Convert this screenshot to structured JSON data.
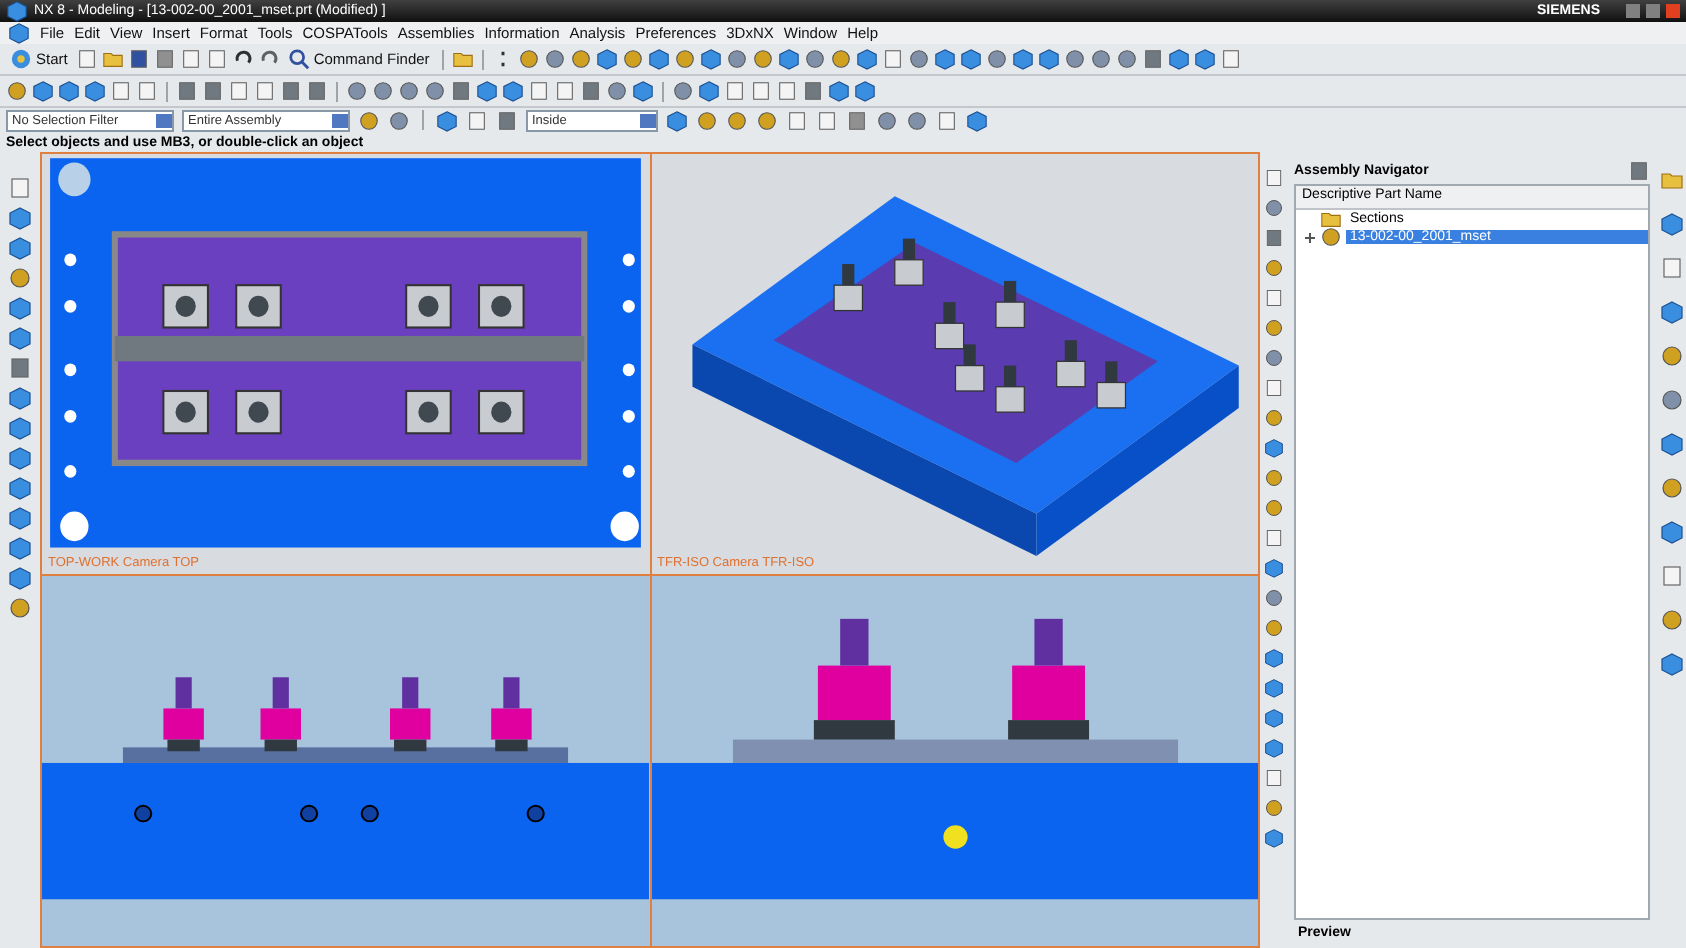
{
  "window": {
    "title": "NX 8 - Modeling - [13-002-00_2001_mset.prt (Modified) ]",
    "brand": "SIEMENS"
  },
  "menu": [
    "File",
    "Edit",
    "View",
    "Insert",
    "Format",
    "Tools",
    "COSPATools",
    "Assemblies",
    "Information",
    "Analysis",
    "Preferences",
    "3DxNX",
    "Window",
    "Help"
  ],
  "toolbar": {
    "start": "Start",
    "command_finder": "Command Finder"
  },
  "filter_bar": {
    "type_filter": "No Selection Filter",
    "scope": "Entire Assembly",
    "mode": "Inside"
  },
  "status": "Select objects and use MB3, or double-click an object",
  "viewports": [
    {
      "kind": "top",
      "label": "TOP-WORK Camera TOP"
    },
    {
      "kind": "iso",
      "label": "TFR-ISO Camera TFR-ISO"
    },
    {
      "kind": "front"
    },
    {
      "kind": "side"
    }
  ],
  "navigator": {
    "title": "Assembly Navigator",
    "column": "Descriptive Part Name",
    "nodes": [
      {
        "kind": "folder",
        "label": "Sections",
        "selected": false
      },
      {
        "kind": "assembly",
        "label": "13-002-00_2001_mset",
        "selected": true
      }
    ],
    "footer": "Preview"
  }
}
